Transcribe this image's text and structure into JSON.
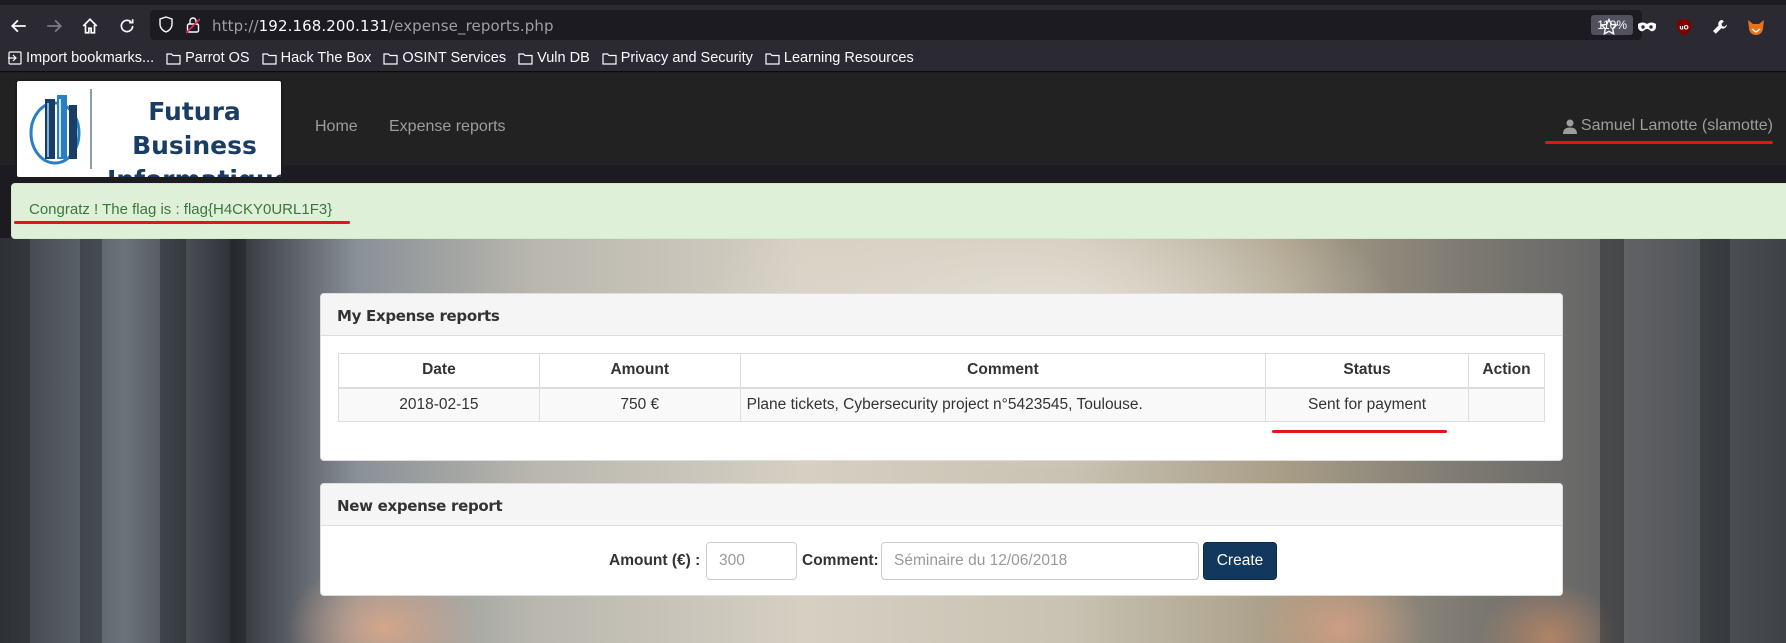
{
  "browser": {
    "url_prefix": "http://",
    "url_host": "192.168.200.131",
    "url_path": "/expense_reports.php",
    "zoom": "110%",
    "bookmarks": [
      {
        "label": "Import bookmarks...",
        "icon": "import-icon"
      },
      {
        "label": "Parrot OS",
        "icon": "folder-icon"
      },
      {
        "label": "Hack The Box",
        "icon": "folder-icon"
      },
      {
        "label": "OSINT Services",
        "icon": "folder-icon"
      },
      {
        "label": "Vuln DB",
        "icon": "folder-icon"
      },
      {
        "label": "Privacy and Security",
        "icon": "folder-icon"
      },
      {
        "label": "Learning Resources",
        "icon": "folder-icon"
      }
    ]
  },
  "site": {
    "logo_line1": "Futura Business",
    "logo_line2": "Informatique",
    "nav": [
      "Home",
      "Expense reports"
    ],
    "user": "Samuel Lamotte (slamotte)"
  },
  "alert": {
    "text": "Congratz ! The flag is : flag{H4CKY0URL1F3}"
  },
  "reports_panel": {
    "title": "My Expense reports",
    "columns": [
      "Date",
      "Amount",
      "Comment",
      "Status",
      "Action"
    ],
    "rows": [
      {
        "date": "2018-02-15",
        "amount": "750 €",
        "comment": "Plane tickets, Cybersecurity project n°5423545, Toulouse.",
        "status": "Sent for payment",
        "action": ""
      }
    ]
  },
  "new_panel": {
    "title": "New expense report",
    "amount_label": "Amount (€) :",
    "amount_placeholder": "300",
    "comment_label": "Comment:",
    "comment_placeholder": "Séminaire du 12/06/2018",
    "create_label": "Create"
  },
  "colors": {
    "alert_bg": "#dff0d8",
    "alert_text": "#3c763d",
    "navbar_bg": "#222222",
    "create_button_bg": "#12395d",
    "annotation_red": "#e0161a"
  }
}
